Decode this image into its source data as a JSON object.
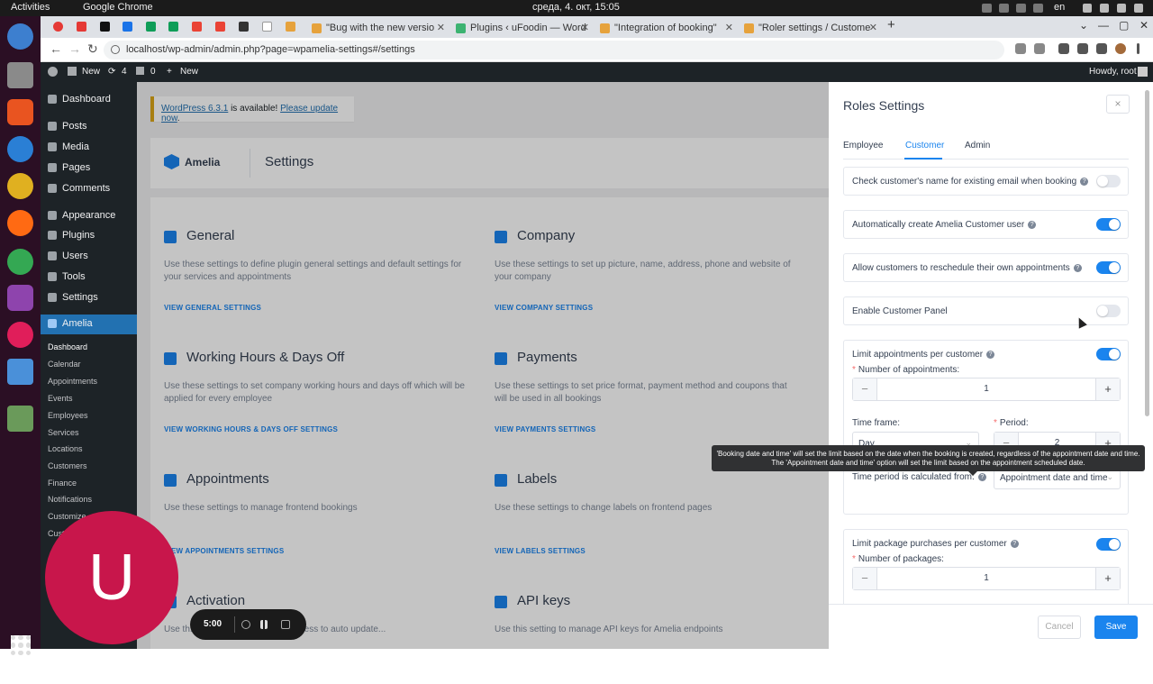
{
  "os": {
    "activities": "Activities",
    "app": "Google Chrome",
    "clock": "среда, 4. окт, 15:05",
    "lang": "en"
  },
  "browser": {
    "tabs": [
      {
        "label": "\"Bug with the new versio"
      },
      {
        "label": "Plugins ‹ uFoodin — Word"
      },
      {
        "label": "\"Integration of booking\""
      },
      {
        "label": "\"Roler settings / Custome"
      }
    ],
    "url": "localhost/wp-admin/admin.php?page=wpamelia-settings#/settings"
  },
  "adminbar": {
    "new_site": "New",
    "updates": "4",
    "comments": "0",
    "new": "New",
    "howdy": "Howdy, root"
  },
  "wpmenu": {
    "items": [
      "Dashboard",
      "Posts",
      "Media",
      "Pages",
      "Comments",
      "Appearance",
      "Plugins",
      "Users",
      "Tools",
      "Settings",
      "Amelia"
    ],
    "amelia_sub": [
      "Dashboard",
      "Calendar",
      "Appointments",
      "Events",
      "Employees",
      "Services",
      "Locations",
      "Customers",
      "Finance",
      "Notifications",
      "Customize",
      "Cust..."
    ]
  },
  "notice": {
    "link": "WordPress 6.3.1",
    "mid": " is available! ",
    "update": "Please update now",
    "end": "."
  },
  "amelia": {
    "brand": "Amelia",
    "title": "Settings",
    "cards": [
      {
        "title": "General",
        "desc": "Use these settings to define plugin general settings and default settings for your services and appointments",
        "link": "VIEW GENERAL SETTINGS"
      },
      {
        "title": "Company",
        "desc": "Use these settings to set up picture, name, address, phone and website of your company",
        "link": "VIEW COMPANY SETTINGS"
      },
      {
        "title": "Working Hours & Days Off",
        "desc": "Use these settings to set company working hours and days off which will be applied for every employee",
        "link": "VIEW WORKING HOURS & DAYS OFF SETTINGS"
      },
      {
        "title": "Payments",
        "desc": "Use these settings to set price format, payment method and coupons that will be used in all bookings",
        "link": "VIEW PAYMENTS SETTINGS"
      },
      {
        "title": "Appointments",
        "desc": "Use these settings to manage frontend bookings",
        "link": "VIEW APPOINTMENTS SETTINGS"
      },
      {
        "title": "Labels",
        "desc": "Use these settings to change labels on frontend pages",
        "link": "VIEW LABELS SETTINGS"
      },
      {
        "title": "Activation",
        "desc": "Use th... code so you can have access to auto update...",
        "link": ""
      },
      {
        "title": "API keys",
        "desc": "Use this setting to manage API keys for Amelia endpoints",
        "link": ""
      }
    ]
  },
  "panel": {
    "title": "Roles Settings",
    "close": "×",
    "tabs": [
      "Employee",
      "Customer",
      "Admin"
    ],
    "active_tab": "Customer",
    "rows": [
      {
        "label": "Check customer's name for existing email when booking",
        "on": false
      },
      {
        "label": "Automatically create Amelia Customer user",
        "on": true
      },
      {
        "label": "Allow customers to reschedule their own appointments",
        "on": true
      },
      {
        "label": "Enable Customer Panel",
        "on": false
      }
    ],
    "limit": {
      "label": "Limit appointments per customer",
      "on": true,
      "num_label": "Number of appointments:",
      "num_value": "1",
      "timeframe_label": "Time frame:",
      "timeframe_value": "Day",
      "period_label": "Period:",
      "period_value": "2",
      "calc_label": "Time period is calculated from:",
      "calc_value": "Appointment date and time"
    },
    "tooltip": {
      "line1": "'Booking date and time' will set the limit based on the date when the booking is created, regardless of the appointment date and time.",
      "line2": "The 'Appointment date and time' option will set the limit based on the appointment scheduled date."
    },
    "package": {
      "label": "Limit package purchases per customer",
      "on": true,
      "num_label": "Number of packages:",
      "num_value": "1"
    },
    "cancel": "Cancel",
    "save": "Save"
  },
  "recorder": {
    "avatar_letter": "U",
    "time": "5:00"
  },
  "colors": {
    "accent": "#1a84ee",
    "wp_dark": "#1d2327",
    "wp_blue": "#2271b1",
    "avatar": "#c8164b"
  }
}
